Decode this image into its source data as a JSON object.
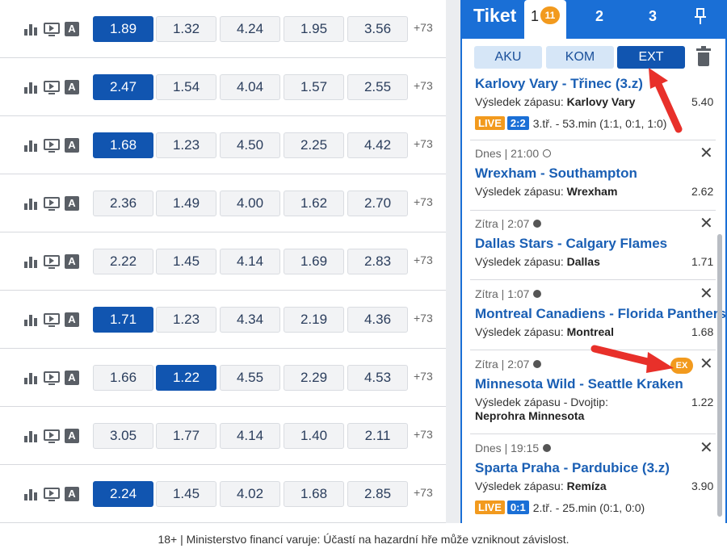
{
  "odds_rows": [
    {
      "odds": [
        "1.89",
        "1.32",
        "4.24",
        "1.95",
        "3.56"
      ],
      "selected": 0,
      "more": "+73"
    },
    {
      "odds": [
        "2.47",
        "1.54",
        "4.04",
        "1.57",
        "2.55"
      ],
      "selected": 0,
      "more": "+73"
    },
    {
      "odds": [
        "1.68",
        "1.23",
        "4.50",
        "2.25",
        "4.42"
      ],
      "selected": 0,
      "more": "+73"
    },
    {
      "odds": [
        "2.36",
        "1.49",
        "4.00",
        "1.62",
        "2.70"
      ],
      "selected": -1,
      "more": "+73"
    },
    {
      "odds": [
        "2.22",
        "1.45",
        "4.14",
        "1.69",
        "2.83"
      ],
      "selected": -1,
      "more": "+73"
    },
    {
      "odds": [
        "1.71",
        "1.23",
        "4.34",
        "2.19",
        "4.36"
      ],
      "selected": 0,
      "more": "+73"
    },
    {
      "odds": [
        "1.66",
        "1.22",
        "4.55",
        "2.29",
        "4.53"
      ],
      "selected": 1,
      "more": "+73"
    },
    {
      "odds": [
        "3.05",
        "1.77",
        "4.14",
        "1.40",
        "2.11"
      ],
      "selected": -1,
      "more": "+73"
    },
    {
      "odds": [
        "2.24",
        "1.45",
        "4.02",
        "1.68",
        "2.85"
      ],
      "selected": 0,
      "more": "+73"
    }
  ],
  "ticket": {
    "title": "Tiket",
    "tab1": "1",
    "tab1_count": "11",
    "tab2": "2",
    "tab3": "3",
    "modes": {
      "aku": "AKU",
      "kom": "KOM",
      "ext": "EXT"
    },
    "bets": [
      {
        "head": "",
        "match": "Karlovy Vary - Třinec (3.z)",
        "type_label": "Výsledek zápasu:",
        "type_value": "Karlovy Vary",
        "odd": "5.40",
        "live": "LIVE",
        "score": "2:2",
        "live_text": "3.tř. - 53.min (1:1, 0:1, 1:0)"
      },
      {
        "head": "Dnes | 21:00",
        "match": "Wrexham - Southampton",
        "type_label": "Výsledek zápasu:",
        "type_value": "Wrexham",
        "odd": "2.62"
      },
      {
        "head": "Zítra | 2:07",
        "match": "Dallas Stars - Calgary Flames",
        "type_label": "Výsledek zápasu:",
        "type_value": "Dallas",
        "odd": "1.71"
      },
      {
        "head": "Zítra | 1:07",
        "match": "Montreal Canadiens - Florida Panthers",
        "type_label": "Výsledek zápasu:",
        "type_value": "Montreal",
        "odd": "1.68"
      },
      {
        "head": "Zítra | 2:07",
        "match": "Minnesota Wild - Seattle Kraken",
        "type_label": "Výsledek zápasu - Dvojtip:",
        "type_value": "Neprohra Minnesota",
        "odd": "1.22",
        "badge": "EX"
      },
      {
        "head": "Dnes | 19:15",
        "match": "Sparta Praha - Pardubice (3.z)",
        "type_label": "Výsledek zápasu:",
        "type_value": "Remíza",
        "odd": "3.90",
        "live": "LIVE",
        "score": "0:1",
        "live_text": "2.tř. - 25.min (0:1, 0:0)"
      }
    ]
  },
  "footer": "18+ | Ministerstvo financí varuje: Účastí na hazardní hře může vzniknout závislost.",
  "colors": {
    "accent": "#1a6fd6",
    "selected": "#1155b0",
    "badge": "#f29a1e",
    "arrow": "#e8302a"
  }
}
